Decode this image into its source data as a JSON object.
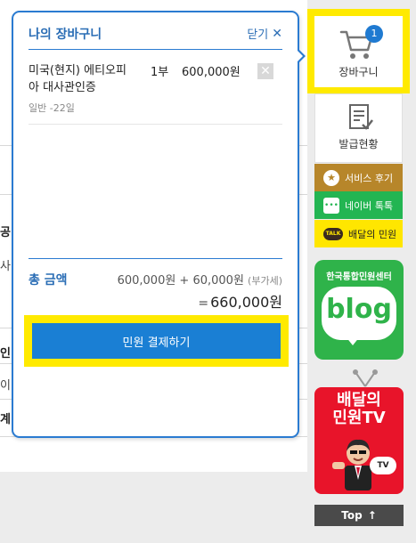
{
  "background": {
    "fragments": [
      "공",
      "사",
      "인",
      "이",
      "계"
    ]
  },
  "cart": {
    "title": "나의 장바구니",
    "close_label": "닫기",
    "item": {
      "name": "미국(현지) 에티오피아 대사관인증",
      "qty": "1부",
      "price": "600,000원",
      "sub": "일반 -22일"
    },
    "total": {
      "label": "총 금액",
      "breakdown_main": "600,000원 + 60,000원",
      "vat": "(부가세)",
      "eq": "=",
      "sum": "660,000원"
    },
    "pay_label": "민원 결제하기"
  },
  "sidebar": {
    "cart_label": "장바구니",
    "cart_count": "1",
    "issue_label": "발급현황",
    "review_label": "서비스 후기",
    "naver_label": "네이버 톡톡",
    "kakao_label": "배달의 민원",
    "kakao_icon_text": "TALK",
    "blog_title": "한국통합민원센터",
    "blog_text": "blog",
    "tv_title_line1": "배달의",
    "tv_title_line2": "민원TV",
    "tv_bubble": "TV",
    "top_label": "Top"
  },
  "colors": {
    "accent": "#2a7bd1",
    "highlight": "#ffea00",
    "pay_button": "#1a7fd4",
    "review": "#b7862a",
    "naver": "#23b552",
    "kakao": "#ffe600",
    "blog": "#2fb34a",
    "tv": "#e8142a"
  }
}
